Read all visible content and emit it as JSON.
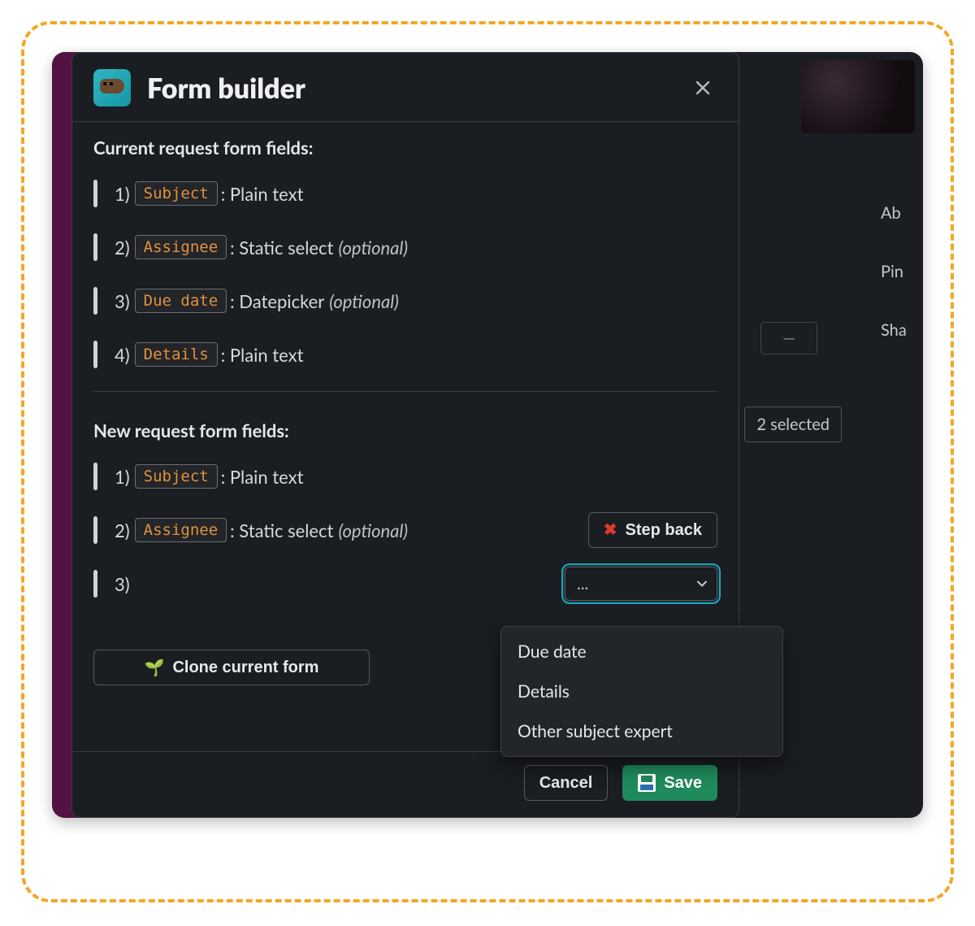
{
  "modal": {
    "title": "Form builder",
    "close_label": "Close"
  },
  "section_current": {
    "title": "Current request form fields:",
    "fields": [
      {
        "idx": "1)",
        "chip": "Subject",
        "type": ": Plain text",
        "optional": ""
      },
      {
        "idx": "2)",
        "chip": "Assignee",
        "type": ": Static select",
        "optional": "(optional)"
      },
      {
        "idx": "3)",
        "chip": "Due date",
        "type": ": Datepicker",
        "optional": "(optional)"
      },
      {
        "idx": "4)",
        "chip": "Details",
        "type": ": Plain text",
        "optional": ""
      }
    ]
  },
  "section_new": {
    "title": "New request form fields:",
    "fields": [
      {
        "idx": "1)",
        "chip": "Subject",
        "type": ": Plain text",
        "optional": ""
      },
      {
        "idx": "2)",
        "chip": "Assignee",
        "type": ": Static select",
        "optional": "(optional)"
      },
      {
        "idx": "3)",
        "chip": "",
        "type": "",
        "optional": ""
      }
    ],
    "step_back_label": "Step back",
    "select_placeholder": "...",
    "options": [
      "Due date",
      "Details",
      "Other subject expert"
    ]
  },
  "buttons": {
    "clone": "Clone current form",
    "cancel": "Cancel",
    "save": "Save"
  },
  "side": {
    "a": "Ab",
    "b": "Pin",
    "c": "Sha",
    "selected": "2 selected",
    "dash": "—"
  }
}
